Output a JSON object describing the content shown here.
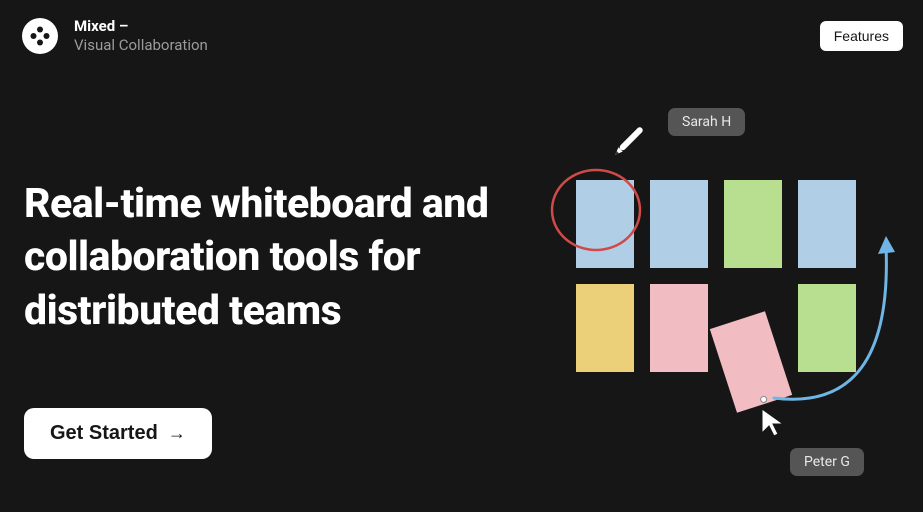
{
  "brand": {
    "title": "Mixed –",
    "subtitle": "Visual Collaboration"
  },
  "nav": {
    "features": "Features"
  },
  "hero": {
    "heading": "Real-time whiteboard and collaboration tools for distributed teams",
    "cta": "Get Started"
  },
  "collaborators": {
    "user1": "Sarah H",
    "user2": "Peter G"
  },
  "colors": {
    "blue": "#b0cfe6",
    "green": "#b7df8f",
    "yellow": "#ecd079",
    "pink": "#f1bdc3",
    "annotation_red": "#d04a4a",
    "arrow_blue": "#6fb5e6",
    "tag_bg": "#555555"
  },
  "notes": [
    {
      "row": 0,
      "col": 0,
      "color": "blue"
    },
    {
      "row": 0,
      "col": 1,
      "color": "blue"
    },
    {
      "row": 0,
      "col": 2,
      "color": "green"
    },
    {
      "row": 0,
      "col": 3,
      "color": "blue"
    },
    {
      "row": 1,
      "col": 0,
      "color": "yellow"
    },
    {
      "row": 1,
      "col": 1,
      "color": "pink"
    },
    {
      "row": 1,
      "col": 2,
      "color": "pink",
      "dragging": true
    },
    {
      "row": 1,
      "col": 3,
      "color": "green"
    }
  ]
}
